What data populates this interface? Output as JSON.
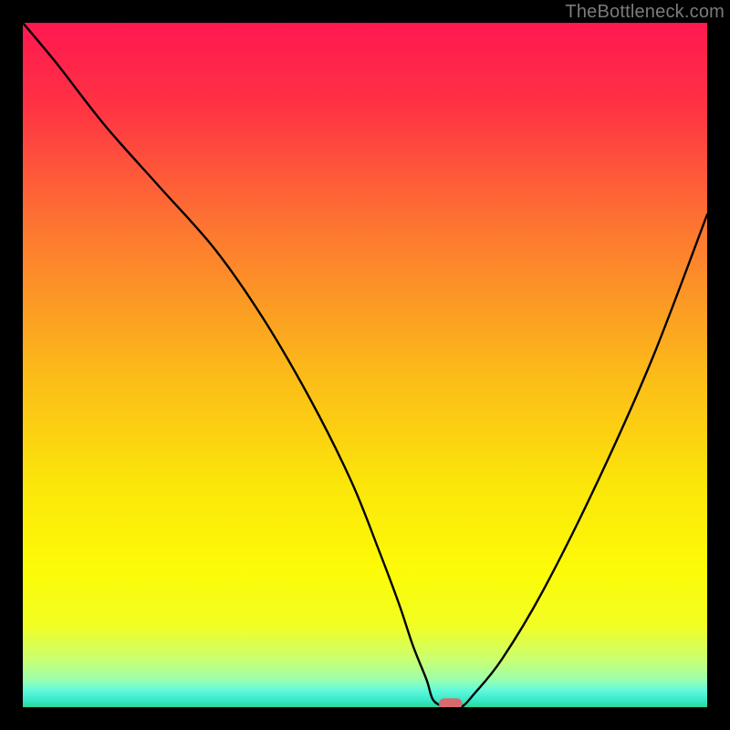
{
  "attribution": "TheBottleneck.com",
  "chart_data": {
    "type": "line",
    "title": "",
    "xlabel": "",
    "ylabel": "",
    "xlim": [
      0,
      100
    ],
    "ylim": [
      0,
      100
    ],
    "grid": false,
    "background_gradient": [
      {
        "stop": 0.0,
        "color": "#ff1850"
      },
      {
        "stop": 0.12,
        "color": "#ff3244"
      },
      {
        "stop": 0.3,
        "color": "#fd7631"
      },
      {
        "stop": 0.5,
        "color": "#fcb71a"
      },
      {
        "stop": 0.68,
        "color": "#fbe70a"
      },
      {
        "stop": 0.8,
        "color": "#fcfb07"
      },
      {
        "stop": 0.88,
        "color": "#f2fe23"
      },
      {
        "stop": 0.93,
        "color": "#caff70"
      },
      {
        "stop": 0.96,
        "color": "#9bffaf"
      },
      {
        "stop": 0.975,
        "color": "#62fadb"
      },
      {
        "stop": 0.99,
        "color": "#37e9c9"
      },
      {
        "stop": 1.0,
        "color": "#2cd397"
      }
    ],
    "series": [
      {
        "name": "bottleneck-curve",
        "x": [
          0,
          5,
          12,
          20,
          28,
          35,
          42,
          48,
          52,
          55,
          57,
          59,
          60,
          62,
          64,
          66,
          70,
          76,
          84,
          92,
          100
        ],
        "y": [
          100,
          94,
          85,
          76,
          67,
          57,
          45,
          33,
          23,
          15,
          9,
          4,
          1,
          0,
          0,
          2,
          7,
          17,
          33,
          51,
          72
        ]
      }
    ],
    "marker": {
      "name": "optimal-point",
      "x": 62.5,
      "y": 0.5,
      "width_pct": 3.4,
      "height_pct": 1.6,
      "color": "#d76a6e"
    }
  }
}
